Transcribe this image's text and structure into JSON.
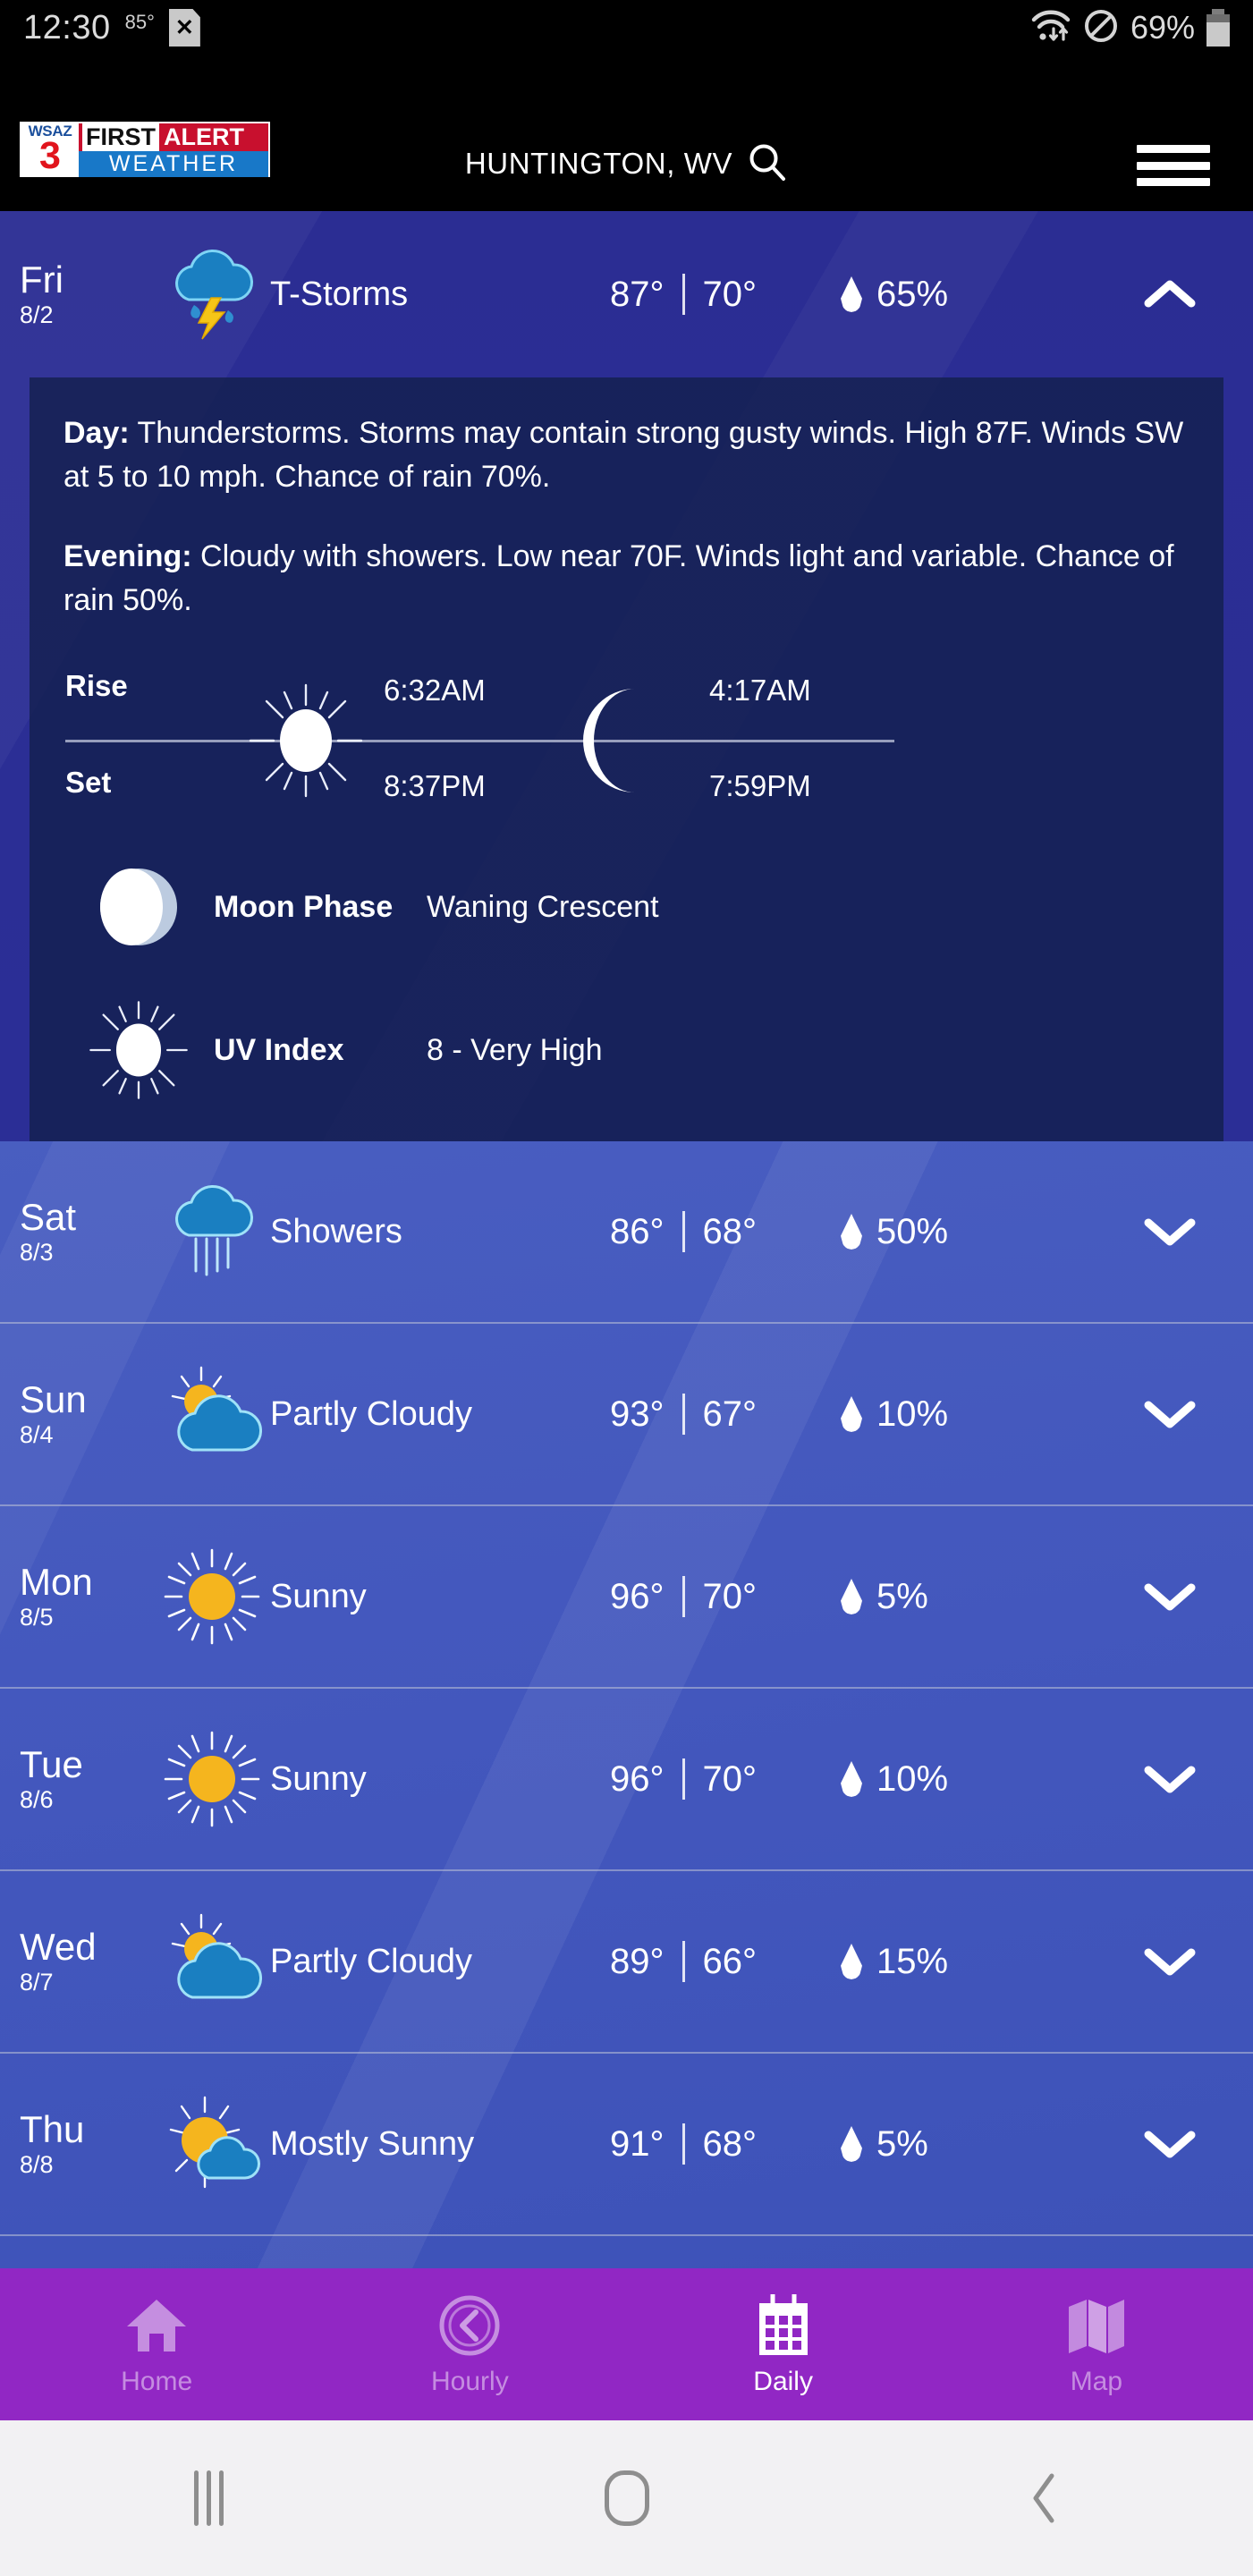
{
  "status_bar": {
    "time": "12:30",
    "temperature": "85°",
    "sim_icon": "sim-card-error-icon",
    "wifi_icon": "wifi-icon",
    "dnd_icon": "do-not-disturb-icon",
    "battery_percent": "69%",
    "battery_icon": "battery-icon"
  },
  "header": {
    "logo": {
      "station": "WSAZ",
      "channel": "3",
      "first": "FIRST",
      "alert": "ALERT",
      "weather": "WEATHER"
    },
    "location": "HUNTINGTON, WV",
    "search_icon": "search-icon",
    "menu_icon": "hamburger-menu-icon"
  },
  "today": {
    "day": "Fri",
    "date": "8/2",
    "icon": "thunderstorm-icon",
    "condition": "T-Storms",
    "high": "87°",
    "low": "70°",
    "precip_icon": "water-drop-icon",
    "precip": "65%",
    "chevron": "chevron-up-icon"
  },
  "detail": {
    "day_label": "Day:",
    "day_text": " Thunderstorms. Storms may contain strong gusty winds. High 87F. Winds SW at 5 to 10 mph. Chance of rain 70%.",
    "evening_label": "Evening:",
    "evening_text": " Cloudy with showers. Low near 70F. Winds light and variable. Chance of rain 50%.",
    "rise_label": "Rise",
    "set_label": "Set",
    "sun_icon": "sun-icon",
    "moon_icon": "crescent-moon-icon",
    "sunrise": "6:32AM",
    "sunset": "8:37PM",
    "moonrise": "4:17AM",
    "moonset": "7:59PM",
    "moon_phase_icon": "moon-phase-icon",
    "moon_phase_label": "Moon Phase",
    "moon_phase_value": "Waning Crescent",
    "uv_icon": "sun-icon",
    "uv_label": "UV Index",
    "uv_value": "8 - Very High"
  },
  "forecast": [
    {
      "day": "Sat",
      "date": "8/3",
      "icon": "rain-showers-icon",
      "condition": "Showers",
      "high": "86°",
      "low": "68°",
      "precip": "50%",
      "chevron": "chevron-down-icon"
    },
    {
      "day": "Sun",
      "date": "8/4",
      "icon": "partly-cloudy-icon",
      "condition": "Partly Cloudy",
      "high": "93°",
      "low": "67°",
      "precip": "10%",
      "chevron": "chevron-down-icon"
    },
    {
      "day": "Mon",
      "date": "8/5",
      "icon": "sunny-icon",
      "condition": "Sunny",
      "high": "96°",
      "low": "70°",
      "precip": "5%",
      "chevron": "chevron-down-icon"
    },
    {
      "day": "Tue",
      "date": "8/6",
      "icon": "sunny-icon",
      "condition": "Sunny",
      "high": "96°",
      "low": "70°",
      "precip": "10%",
      "chevron": "chevron-down-icon"
    },
    {
      "day": "Wed",
      "date": "8/7",
      "icon": "partly-cloudy-icon",
      "condition": "Partly Cloudy",
      "high": "89°",
      "low": "66°",
      "precip": "15%",
      "chevron": "chevron-down-icon"
    },
    {
      "day": "Thu",
      "date": "8/8",
      "icon": "mostly-sunny-icon",
      "condition": "Mostly Sunny",
      "high": "91°",
      "low": "68°",
      "precip": "5%",
      "chevron": "chevron-down-icon"
    }
  ],
  "bottom_nav": {
    "items": [
      {
        "label": "Home",
        "icon": "home-icon",
        "active": false
      },
      {
        "label": "Hourly",
        "icon": "clock-icon",
        "active": false
      },
      {
        "label": "Daily",
        "icon": "calendar-icon",
        "active": true
      },
      {
        "label": "Map",
        "icon": "map-icon",
        "active": false
      }
    ]
  },
  "system_nav": {
    "recents_icon": "recents-icon",
    "home_icon": "home-circle-icon",
    "back_icon": "back-chevron-icon"
  },
  "colors": {
    "nav_purple": "#9127c4",
    "panel_blue": "#14204e",
    "today_blue": "#2b2d93",
    "list_blue": "#4a5fc1",
    "logo_red": "#c8102e",
    "logo_blue": "#1878c8",
    "sun_yellow": "#f5b51e",
    "cloud_blue": "#1a7fc1"
  }
}
